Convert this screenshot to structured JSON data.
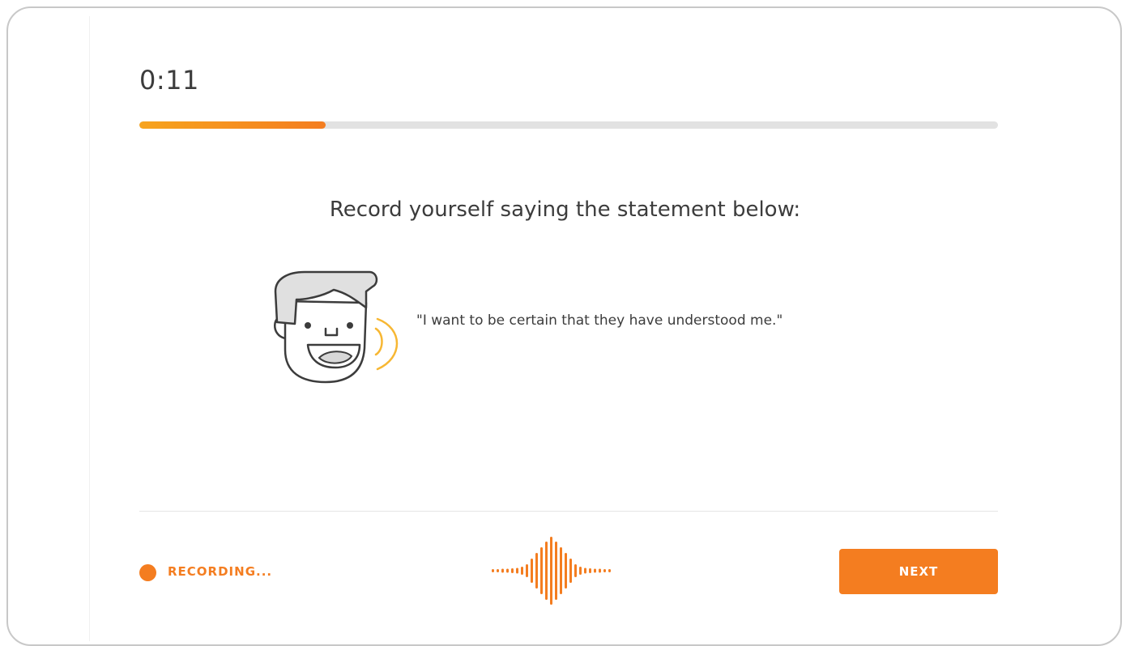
{
  "timer": {
    "value": "0:11",
    "progress_fraction": 0.217
  },
  "prompt": {
    "instruction": "Record yourself saying the statement below:",
    "statement": "\"I want to be certain that they have understood me.\"",
    "illustration_icon": "speaking-face-icon"
  },
  "footer": {
    "recording_label": "RECORDING...",
    "recording_icon": "recording-dot-icon",
    "waveform_icon": "audio-waveform-icon",
    "next_label": "NEXT"
  },
  "colors": {
    "accent": "#f47d20",
    "accent_light": "#f7a41e",
    "track": "#e2e2e2",
    "text": "#3c3c3c",
    "face_hair": "#e0e0e0",
    "sound_waves": "#f7b733"
  }
}
